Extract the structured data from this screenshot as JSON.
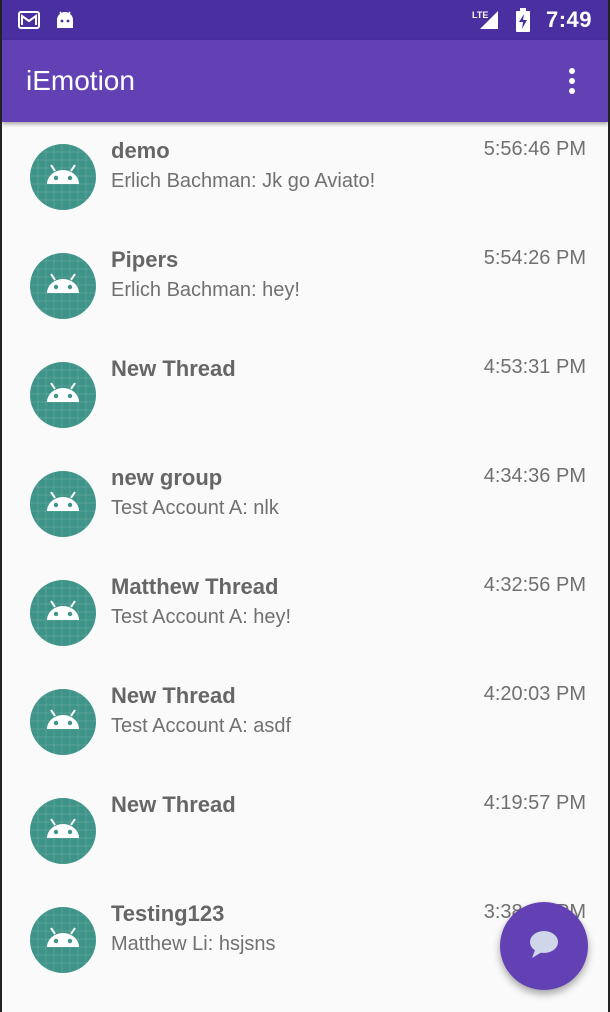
{
  "status_bar": {
    "left_icons": [
      "gmail-icon",
      "android-icon"
    ],
    "network": "LTE",
    "time": "7:49"
  },
  "app_bar": {
    "title": "iEmotion",
    "overflow_icon": "more-vert-icon"
  },
  "threads": [
    {
      "name": "demo",
      "preview": "Erlich Bachman: Jk go Aviato!",
      "time": "5:56:46 PM"
    },
    {
      "name": "Pipers",
      "preview": "Erlich Bachman: hey!",
      "time": "5:54:26 PM"
    },
    {
      "name": "New Thread",
      "preview": "",
      "time": "4:53:31 PM"
    },
    {
      "name": "new group",
      "preview": "Test Account A: nlk",
      "time": "4:34:36 PM"
    },
    {
      "name": "Matthew Thread",
      "preview": "Test Account A: hey!",
      "time": "4:32:56 PM"
    },
    {
      "name": "New Thread",
      "preview": "Test Account A: asdf",
      "time": "4:20:03 PM"
    },
    {
      "name": "New Thread",
      "preview": "",
      "time": "4:19:57 PM"
    },
    {
      "name": "Testing123",
      "preview": "Matthew Li: hsjsns",
      "time": "3:38:07 PM"
    }
  ],
  "fab": {
    "icon": "chat-bubble-icon"
  },
  "colors": {
    "status_bar": "#4a2fa0",
    "app_bar": "#6241b5",
    "avatar": "#3e9488",
    "fab": "#6241b5"
  }
}
